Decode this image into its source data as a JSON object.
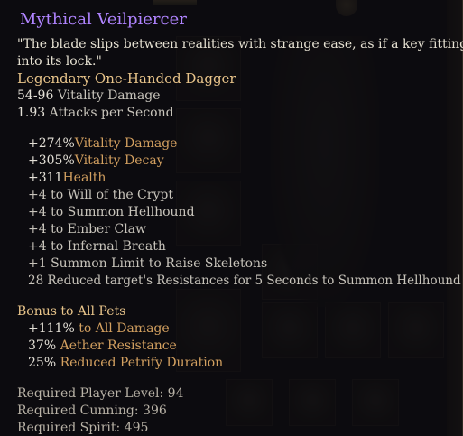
{
  "item": {
    "name": "Mythical Veilpiercer",
    "flavor_line1": "\"The blade slips between realities with strange ease, as if a key fitting",
    "flavor_line2": "into its lock.\"",
    "type": "Legendary One-Handed Dagger",
    "damage_value": "54-96",
    "damage_type": "Vitality Damage",
    "attack_speed_value": "1.93",
    "attack_speed_label": "Attacks per Second"
  },
  "stats": [
    {
      "value": "+274%",
      "name": "Vitality Damage"
    },
    {
      "value": "+305%",
      "name": "Vitality Decay"
    },
    {
      "value": "+311",
      "name": "Health"
    }
  ],
  "skill_bonuses": [
    "+4 to Will of the Crypt",
    "+4 to Summon Hellhound",
    "+4 to Ember Claw",
    "+4 to Infernal Breath",
    "+1 Summon Limit to Raise Skeletons",
    "28 Reduced target's Resistances for 5 Seconds to Summon Hellhound"
  ],
  "pet_bonus": {
    "header": "Bonus to All Pets",
    "stats": [
      {
        "value": "+111%",
        "name": "to All Damage"
      },
      {
        "value": "37%",
        "name": "Aether Resistance"
      },
      {
        "value": "25%",
        "name": "Reduced Petrify Duration"
      }
    ]
  },
  "requirements": [
    "Required Player Level: 94",
    "Required Cunning: 396",
    "Required Spirit: 495"
  ],
  "colors": {
    "title": "#b084ff",
    "type": "#e8c48a",
    "stat_name": "#d3a060",
    "text": "#e3dfd6"
  }
}
